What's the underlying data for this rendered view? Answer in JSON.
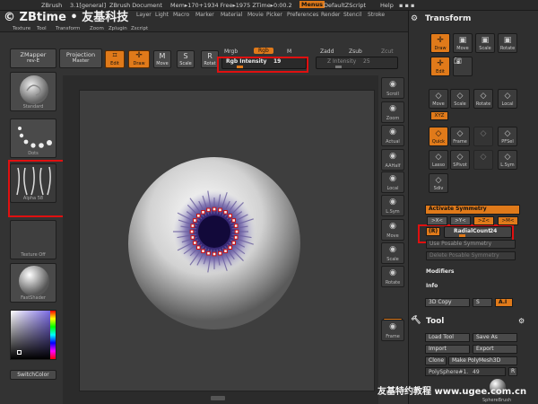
{
  "titlebar": {
    "app": "ZBrush",
    "version": "3.1[general]",
    "document": "ZBrush Document",
    "memory": "Mem▸170+1934 Free▸1975 ZTime▸0:00.2",
    "menus_label": "Menus",
    "script": "DefaultZScript",
    "help": "Help"
  },
  "watermark": "© ZBtime • 友基科技",
  "menus": [
    "Layer",
    "Light",
    "Macro",
    "Marker",
    "Material",
    "Movie",
    "Picker",
    "Preferences",
    "Render",
    "Stencil",
    "Stroke"
  ],
  "submenus": [
    "Texture",
    "Tool",
    "Transform",
    "Zoom",
    "Zplugin",
    "Zscript"
  ],
  "top": {
    "zmapper_label": "ZMapper",
    "zmapper_version": "rev-E",
    "projection_label": "Projection",
    "projection_value": "Master",
    "edit": "Edit",
    "draw": "Draw",
    "move": "Move",
    "scale": "Scale",
    "rotate": "Rotat",
    "mrgb": "Mrgb",
    "rgb": "Rgb",
    "m": "M",
    "rgb_intensity_label": "Rgb Intensity",
    "rgb_intensity_value": "19",
    "rgb_intensity_level": 0.19,
    "zadd": "Zadd",
    "zsub": "Zsub",
    "zcut": "Zcut",
    "z_intensity_label": "Z Intensity",
    "z_intensity_value": "25",
    "z_intensity_level": 0.25
  },
  "left": {
    "material_label": "Standard",
    "stroke_label": "Dots",
    "alpha_label": "Alpha 58",
    "texture_label": "Texture Off",
    "flat_label": "FastShader",
    "switch_color": "SwitchColor"
  },
  "right_shelf": [
    "Scroll",
    "Zoom",
    "Actual",
    "AAHalf",
    "Local",
    "L.Sym",
    "Move",
    "Scale",
    "Rotate",
    "XYZ",
    "Frame"
  ],
  "tray": {
    "transform_header": "Transform",
    "transform_top": [
      "Draw",
      "Move",
      "Scale",
      "Rotate",
      "Edit"
    ],
    "transform_row2": [
      "Move",
      "Scale",
      "Rotate",
      "Local"
    ],
    "xyz": "XYZ",
    "transform_row3": [
      "Quick",
      "Frame",
      "",
      "PFSel"
    ],
    "transform_row4": [
      "Lasso",
      "SPivot",
      "",
      "L.Sym"
    ],
    "transform_row5": [
      "Sdiv"
    ],
    "activate_symmetry": "Activate Symmetry",
    "axes": [
      ">X<",
      ">Y<",
      ">Z<",
      ">M<"
    ],
    "r_label": "(R)",
    "radial_count_label": "RadialCount",
    "radial_count_value": "24",
    "radial_count_level": 0.24,
    "use_posable": "Use Posable Symmetry",
    "delete_posable": "Delete Posable Symmetry",
    "modifiers": "Modifiers",
    "info": "Info",
    "copy_3d": "3D Copy",
    "s_label": "S",
    "ai_label": "A.I",
    "tool_header": "Tool",
    "load_tool": "Load Tool",
    "save_as": "Save As",
    "import": "Import",
    "export": "Export",
    "clone": "Clone",
    "make_polymesh": "Make PolyMesh3D",
    "polysphere": "PolySphere#1.",
    "polysphere_value": "49",
    "r_button": "R",
    "sphere_brush": "SphereBrush"
  },
  "footer_watermark": "友基特约教程 www.ugee.com.cn",
  "colors": {
    "accent": "#e07a1a",
    "highlight_box": "#e01010",
    "background": "#3a3a3a"
  }
}
